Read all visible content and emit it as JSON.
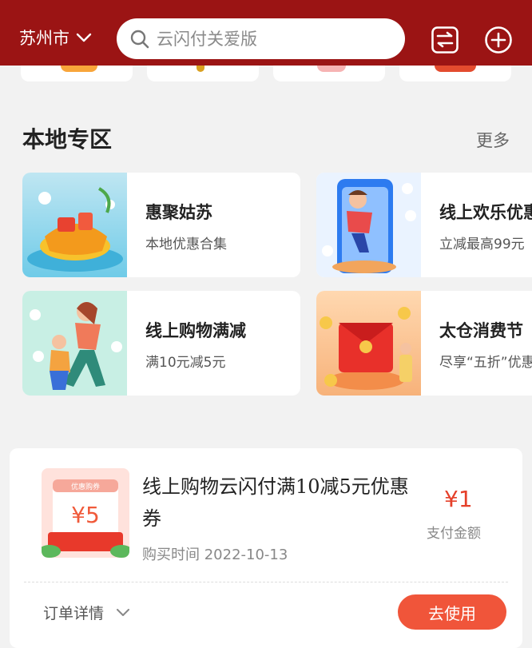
{
  "header": {
    "city": "苏州市",
    "search_placeholder": "云闪付关爱版"
  },
  "section": {
    "title": "本地专区",
    "more": "更多"
  },
  "cards": [
    {
      "title": "惠聚姑苏",
      "subtitle": "本地优惠合集"
    },
    {
      "title": "线上欢乐优惠",
      "subtitle": "立减最高99元"
    },
    {
      "title": "线上购物满减",
      "subtitle": "满10元减5元"
    },
    {
      "title": "太仓消费节",
      "subtitle": "尽享“五折”优惠"
    }
  ],
  "order": {
    "title": "线上购物云闪付满10减5元优惠券",
    "purchase_time": "购买时间 2022-10-13",
    "price": "¥1",
    "price_label": "支付金额",
    "detail_label": "订单详情",
    "use_button": "去使用",
    "coupon_badge": "优惠购券",
    "coupon_value": "¥5"
  },
  "colors": {
    "header_bg": "#9b1414",
    "accent": "#f0553a",
    "price": "#e5402a"
  },
  "icons": [
    "chevron-down-icon",
    "search-icon",
    "switch-icon",
    "add-icon"
  ]
}
